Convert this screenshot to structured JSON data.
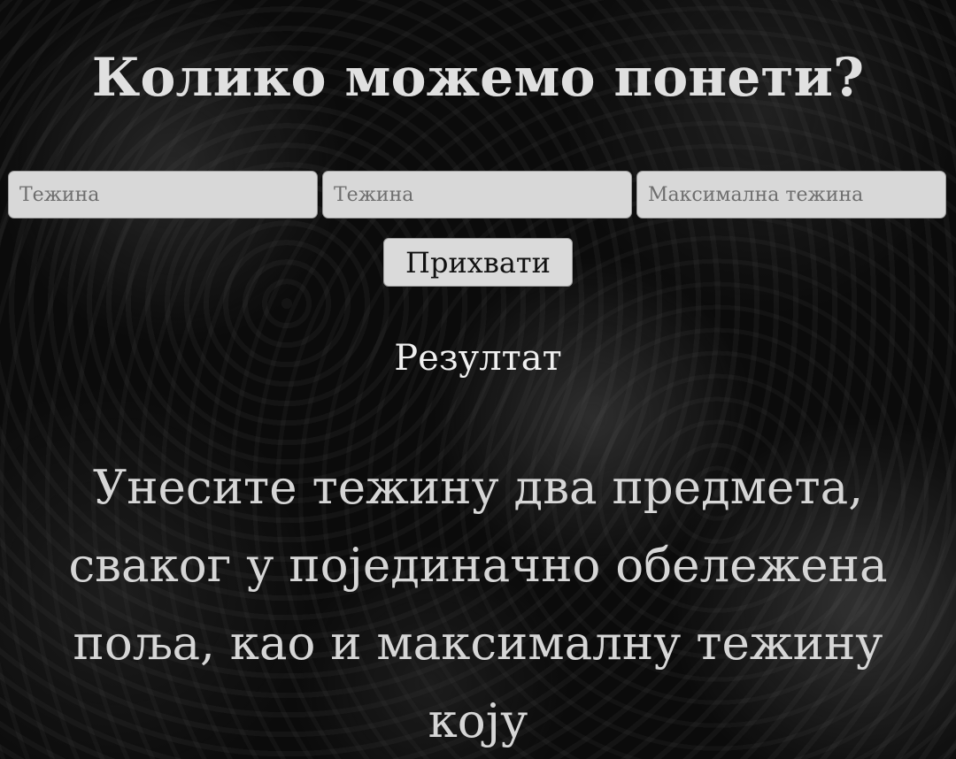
{
  "header": {
    "title": "Колико можемо понети?"
  },
  "form": {
    "weight1_placeholder": "Тежина",
    "weight2_placeholder": "Тежина",
    "max_weight_placeholder": "Максимална тежина",
    "submit_label": "Прихвати"
  },
  "result": {
    "label": "Резултат"
  },
  "instructions": {
    "text": "Унесите тежину два предмета, сваког у појединачно обележена поља, као и максималну тежину коју"
  },
  "colors": {
    "background": "#0b0b0b",
    "text": "#e0e0e0",
    "input_bg": "#d8d8d8"
  }
}
